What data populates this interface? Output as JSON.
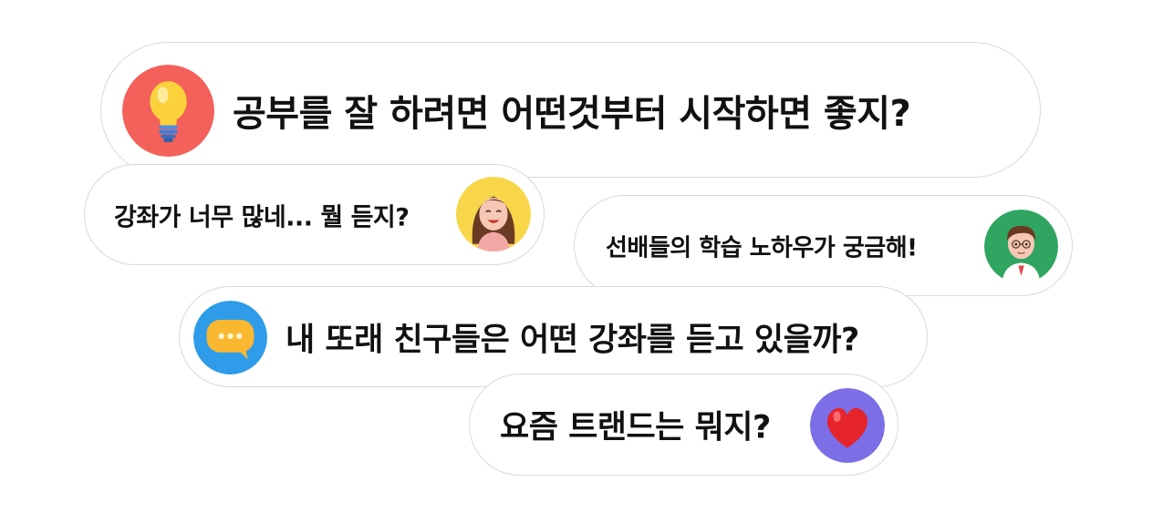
{
  "bubbles": [
    {
      "text": "공부를 잘 하려면 어떤것부터 시작하면 좋지?",
      "icon": "lightbulb-icon",
      "icon_bg": "#f3615a"
    },
    {
      "text": "강좌가 너무 많네... 뭘 듣지?",
      "icon": "girl-avatar",
      "icon_bg": "#f7d64a"
    },
    {
      "text": "선배들의 학습 노하우가 궁금해!",
      "icon": "boy-avatar",
      "icon_bg": "#2fa561"
    },
    {
      "text": "내 또래 친구들은 어떤 강좌를 듣고 있을까?",
      "icon": "speech-bubble-icon",
      "icon_bg": "#2e9ce8"
    },
    {
      "text": "요즘 트랜드는 뭐지?",
      "icon": "heart-icon",
      "icon_bg": "#7b6ee6"
    }
  ],
  "colors": {
    "border": "#d9d9d9",
    "text": "#111111"
  }
}
